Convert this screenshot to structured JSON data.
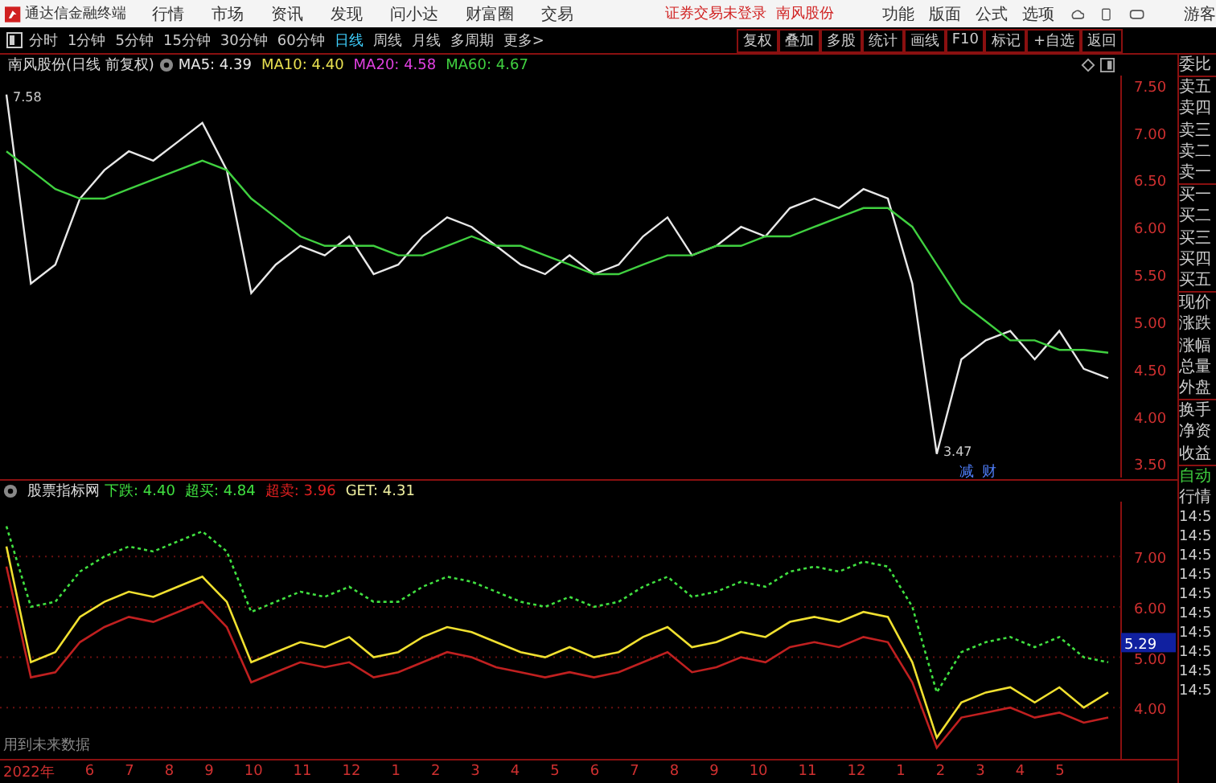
{
  "app": {
    "title": "通达信金融终端",
    "menu": [
      "行情",
      "市场",
      "资讯",
      "发现",
      "问小达",
      "财富圈",
      "交易"
    ],
    "login_status": "证券交易未登录",
    "stock_name": "南风股份",
    "right_menu": [
      "功能",
      "版面",
      "公式",
      "选项"
    ],
    "user": "游客"
  },
  "toolbar": {
    "periods": [
      {
        "label": "分时",
        "selected": false
      },
      {
        "label": "1分钟",
        "selected": false
      },
      {
        "label": "5分钟",
        "selected": false
      },
      {
        "label": "15分钟",
        "selected": false
      },
      {
        "label": "30分钟",
        "selected": false
      },
      {
        "label": "60分钟",
        "selected": false
      },
      {
        "label": "日线",
        "selected": true
      },
      {
        "label": "周线",
        "selected": false
      },
      {
        "label": "月线",
        "selected": false
      },
      {
        "label": "多周期",
        "selected": false
      },
      {
        "label": "更多>",
        "selected": false
      }
    ],
    "buttons": [
      "复权",
      "叠加",
      "多股",
      "统计",
      "画线",
      "F10",
      "标记",
      "+自选",
      "返回"
    ]
  },
  "main_chart": {
    "title": "南风股份(日线 前复权)",
    "legend": [
      {
        "text": "MA5: 4.39",
        "color": "#e8e8e8"
      },
      {
        "text": "MA10: 4.40",
        "color": "#e8e050"
      },
      {
        "text": "MA20: 4.58",
        "color": "#e040e0"
      },
      {
        "text": "MA60: 4.67",
        "color": "#40d040"
      }
    ],
    "chart_data": {
      "type": "line",
      "ylim": [
        3.35,
        7.6
      ],
      "yticks": [
        {
          "value": 7.5,
          "label": "7.50"
        },
        {
          "value": 7,
          "label": "7.00"
        },
        {
          "value": 6.5,
          "label": "6.50"
        },
        {
          "value": 6,
          "label": "6.00"
        },
        {
          "value": 5.5,
          "label": "5.50"
        },
        {
          "value": 5,
          "label": "5.00"
        },
        {
          "value": 4.5,
          "label": "4.50"
        },
        {
          "value": 4,
          "label": "4.00"
        },
        {
          "value": 3.5,
          "label": "3.50"
        }
      ],
      "series": [
        {
          "color": "#e8e8e8",
          "values": [
            7.4,
            5.4,
            5.6,
            6.3,
            6.6,
            6.8,
            6.7,
            6.9,
            7.1,
            6.6,
            5.3,
            5.6,
            5.8,
            5.7,
            5.9,
            5.5,
            5.6,
            5.9,
            6.1,
            6.0,
            5.8,
            5.6,
            5.5,
            5.7,
            5.5,
            5.6,
            5.9,
            6.1,
            5.7,
            5.8,
            6.0,
            5.9,
            6.2,
            6.3,
            6.2,
            6.4,
            6.3,
            5.4,
            3.6,
            4.6,
            4.8,
            4.9,
            4.6,
            4.9,
            4.5,
            4.4
          ]
        },
        {
          "color": "#40d040",
          "values": [
            6.8,
            6.6,
            6.4,
            6.3,
            6.3,
            6.4,
            6.5,
            6.6,
            6.7,
            6.6,
            6.3,
            6.1,
            5.9,
            5.8,
            5.8,
            5.8,
            5.7,
            5.7,
            5.8,
            5.9,
            5.8,
            5.8,
            5.7,
            5.6,
            5.5,
            5.5,
            5.6,
            5.7,
            5.7,
            5.8,
            5.8,
            5.9,
            5.9,
            6.0,
            6.1,
            6.2,
            6.2,
            6.0,
            5.6,
            5.2,
            5.0,
            4.8,
            4.8,
            4.7,
            4.7,
            4.67
          ]
        }
      ],
      "annotations": [
        "7.58",
        "3.47",
        "减",
        "财"
      ]
    }
  },
  "indicator": {
    "title": "股票指标网",
    "legend": [
      {
        "text": "下跌: 4.40",
        "color": "#40e040"
      },
      {
        "text": "超买: 4.84",
        "color": "#40e040"
      },
      {
        "text": "超卖: 3.96",
        "color": "#e02020"
      },
      {
        "text": "GET: 4.31",
        "color": "#f0f0a0"
      }
    ],
    "note": "用到未来数据",
    "chart_data": {
      "type": "line",
      "grid": true,
      "ylim": [
        2.98,
        8.09
      ],
      "yticks": [
        {
          "value": 7,
          "label": "7.00"
        },
        {
          "value": 6,
          "label": "6.00"
        },
        {
          "value": 5,
          "label": "5.00"
        },
        {
          "value": 4,
          "label": "4.00"
        }
      ],
      "series": [
        {
          "color": "#40e040",
          "line_style": "dashed",
          "values": [
            7.6,
            6.0,
            6.1,
            6.7,
            7.0,
            7.2,
            7.1,
            7.3,
            7.5,
            7.1,
            5.9,
            6.1,
            6.3,
            6.2,
            6.4,
            6.1,
            6.1,
            6.4,
            6.6,
            6.5,
            6.3,
            6.1,
            6.0,
            6.2,
            6.0,
            6.1,
            6.4,
            6.6,
            6.2,
            6.3,
            6.5,
            6.4,
            6.7,
            6.8,
            6.7,
            6.9,
            6.8,
            6.0,
            4.3,
            5.1,
            5.3,
            5.4,
            5.2,
            5.4,
            5.0,
            4.9
          ]
        },
        {
          "color": "#f0e030",
          "line_style": "solid",
          "values": [
            7.2,
            4.9,
            5.1,
            5.8,
            6.1,
            6.3,
            6.2,
            6.4,
            6.6,
            6.1,
            4.9,
            5.1,
            5.3,
            5.2,
            5.4,
            5.0,
            5.1,
            5.4,
            5.6,
            5.5,
            5.3,
            5.1,
            5.0,
            5.2,
            5.0,
            5.1,
            5.4,
            5.6,
            5.2,
            5.3,
            5.5,
            5.4,
            5.7,
            5.8,
            5.7,
            5.9,
            5.8,
            4.9,
            3.4,
            4.1,
            4.3,
            4.4,
            4.1,
            4.4,
            4.0,
            4.3
          ]
        },
        {
          "color": "#c02020",
          "line_style": "solid",
          "values": [
            6.8,
            4.6,
            4.7,
            5.3,
            5.6,
            5.8,
            5.7,
            5.9,
            6.1,
            5.6,
            4.5,
            4.7,
            4.9,
            4.8,
            4.9,
            4.6,
            4.7,
            4.9,
            5.1,
            5.0,
            4.8,
            4.7,
            4.6,
            4.7,
            4.6,
            4.7,
            4.9,
            5.1,
            4.7,
            4.8,
            5.0,
            4.9,
            5.2,
            5.3,
            5.2,
            5.4,
            5.3,
            4.5,
            3.2,
            3.8,
            3.9,
            4.0,
            3.8,
            3.9,
            3.7,
            3.8
          ]
        }
      ],
      "annotations": [
        "5.29"
      ]
    }
  },
  "date_axis": [
    "2022年",
    "6",
    "7",
    "8",
    "9",
    "10",
    "11",
    "12",
    "1",
    "2",
    "3",
    "4",
    "5",
    "6",
    "7",
    "8",
    "9",
    "10",
    "11",
    "12",
    "1",
    "2",
    "3",
    "4",
    "5"
  ],
  "sidebar": {
    "groups": [
      [
        "委比"
      ],
      [
        "卖五",
        "卖四",
        "卖三",
        "卖二",
        "卖一"
      ],
      [
        "买一",
        "买二",
        "买三",
        "买四",
        "买五"
      ],
      [
        "现价",
        "涨跌",
        "涨幅",
        "总量",
        "外盘"
      ],
      [
        "换手",
        "净资",
        "收益"
      ]
    ],
    "status": "自动",
    "section": "行情",
    "times": [
      "14:5",
      "14:5",
      "14:5",
      "14:5",
      "14:5",
      "14:5",
      "14:5",
      "14:5",
      "14:5",
      "14:5"
    ]
  }
}
